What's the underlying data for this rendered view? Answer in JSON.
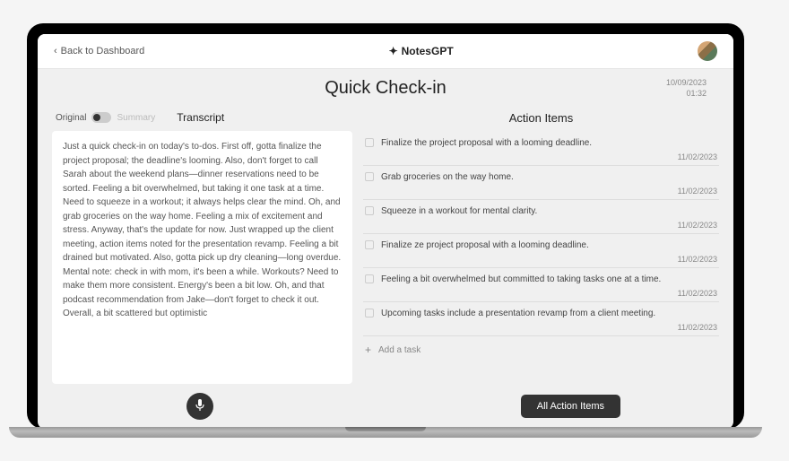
{
  "header": {
    "back_label": "Back to Dashboard",
    "brand": "NotesGPT",
    "brand_icon": "✦"
  },
  "page": {
    "title": "Quick Check-in",
    "date": "10/09/2023",
    "time": "01:32"
  },
  "left": {
    "toggle_original": "Original",
    "toggle_summary": "Summary",
    "section_label": "Transcript",
    "transcript": "Just a quick check-in on today's to-dos. First off, gotta finalize the project proposal; the deadline's looming. Also, don't forget to call Sarah about the weekend plans—dinner reservations need to be sorted. Feeling a bit overwhelmed, but taking it one task at a time. Need to squeeze in a workout; it always helps clear the mind. Oh, and grab groceries on the way home. Feeling a mix of excitement and stress. Anyway, that's the update for now. Just wrapped up the client meeting, action items noted for the presentation revamp. Feeling a bit drained but motivated. Also, gotta pick up dry cleaning—long overdue. Mental note: check in with mom, it's been a while. Workouts? Need to make them more consistent. Energy's been a bit low. Oh, and that podcast recommendation from Jake—don't forget to check it out. Overall, a bit scattered but optimistic"
  },
  "right": {
    "title": "Action Items",
    "items": [
      {
        "text": "Finalize the project proposal with a looming deadline.",
        "date": "11/02/2023"
      },
      {
        "text": "Grab groceries on the way home.",
        "date": "11/02/2023"
      },
      {
        "text": "Squeeze in a workout for mental clarity.",
        "date": "11/02/2023"
      },
      {
        "text": "Finalize ze project proposal with a looming deadline.",
        "date": "11/02/2023"
      },
      {
        "text": "Feeling  a bit overwhelmed but committed to taking tasks one at a time.",
        "date": "11/02/2023"
      },
      {
        "text": "Upcoming tasks include a presentation revamp from a client meeting.",
        "date": "11/02/2023"
      }
    ],
    "add_task_label": "Add a task",
    "all_items_btn": "All Action Items"
  }
}
